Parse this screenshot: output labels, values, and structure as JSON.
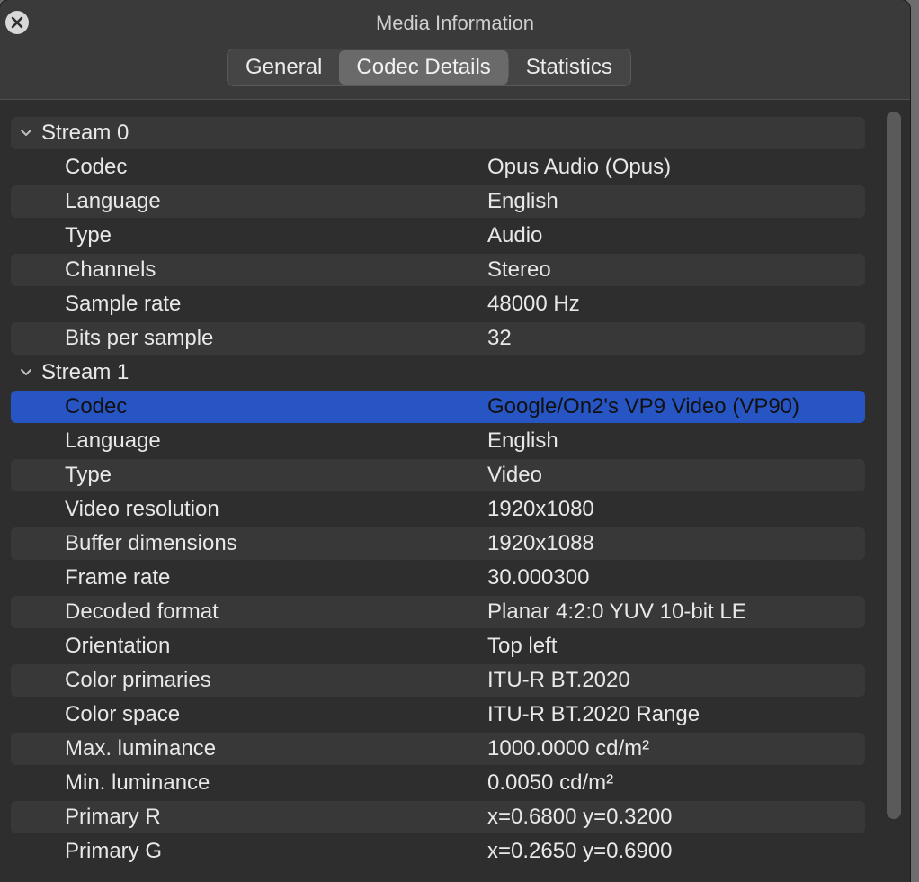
{
  "window": {
    "title": "Media Information"
  },
  "tabs": [
    {
      "label": "General",
      "active": false
    },
    {
      "label": "Codec Details",
      "active": true
    },
    {
      "label": "Statistics",
      "active": false
    }
  ],
  "streams": [
    {
      "label": "Stream 0",
      "expanded": true,
      "rows": [
        {
          "key": "Codec",
          "value": "Opus Audio (Opus)"
        },
        {
          "key": "Language",
          "value": "English"
        },
        {
          "key": "Type",
          "value": "Audio"
        },
        {
          "key": "Channels",
          "value": "Stereo"
        },
        {
          "key": "Sample rate",
          "value": "48000 Hz"
        },
        {
          "key": "Bits per sample",
          "value": "32"
        }
      ]
    },
    {
      "label": "Stream 1",
      "expanded": true,
      "rows": [
        {
          "key": "Codec",
          "value": "Google/On2's VP9 Video (VP90)",
          "selected": true
        },
        {
          "key": "Language",
          "value": "English"
        },
        {
          "key": "Type",
          "value": "Video"
        },
        {
          "key": "Video resolution",
          "value": "1920x1080"
        },
        {
          "key": "Buffer dimensions",
          "value": "1920x1088"
        },
        {
          "key": "Frame rate",
          "value": "30.000300"
        },
        {
          "key": "Decoded format",
          "value": "Planar 4:2:0 YUV 10-bit LE"
        },
        {
          "key": "Orientation",
          "value": "Top left"
        },
        {
          "key": "Color primaries",
          "value": "ITU-R BT.2020"
        },
        {
          "key": "Color space",
          "value": "ITU-R BT.2020 Range"
        },
        {
          "key": "Max. luminance",
          "value": "1000.0000 cd/m²"
        },
        {
          "key": "Min. luminance",
          "value": "0.0050 cd/m²"
        },
        {
          "key": "Primary R",
          "value": "x=0.6800 y=0.3200"
        },
        {
          "key": "Primary G",
          "value": "x=0.2650 y=0.6900"
        }
      ]
    }
  ],
  "colors": {
    "selection": "#2755c4",
    "window_bg": "#2e2e2e",
    "alt_row": "#383838"
  },
  "icons": {
    "close": "close-icon",
    "disclosure": "chevron-down-icon"
  }
}
